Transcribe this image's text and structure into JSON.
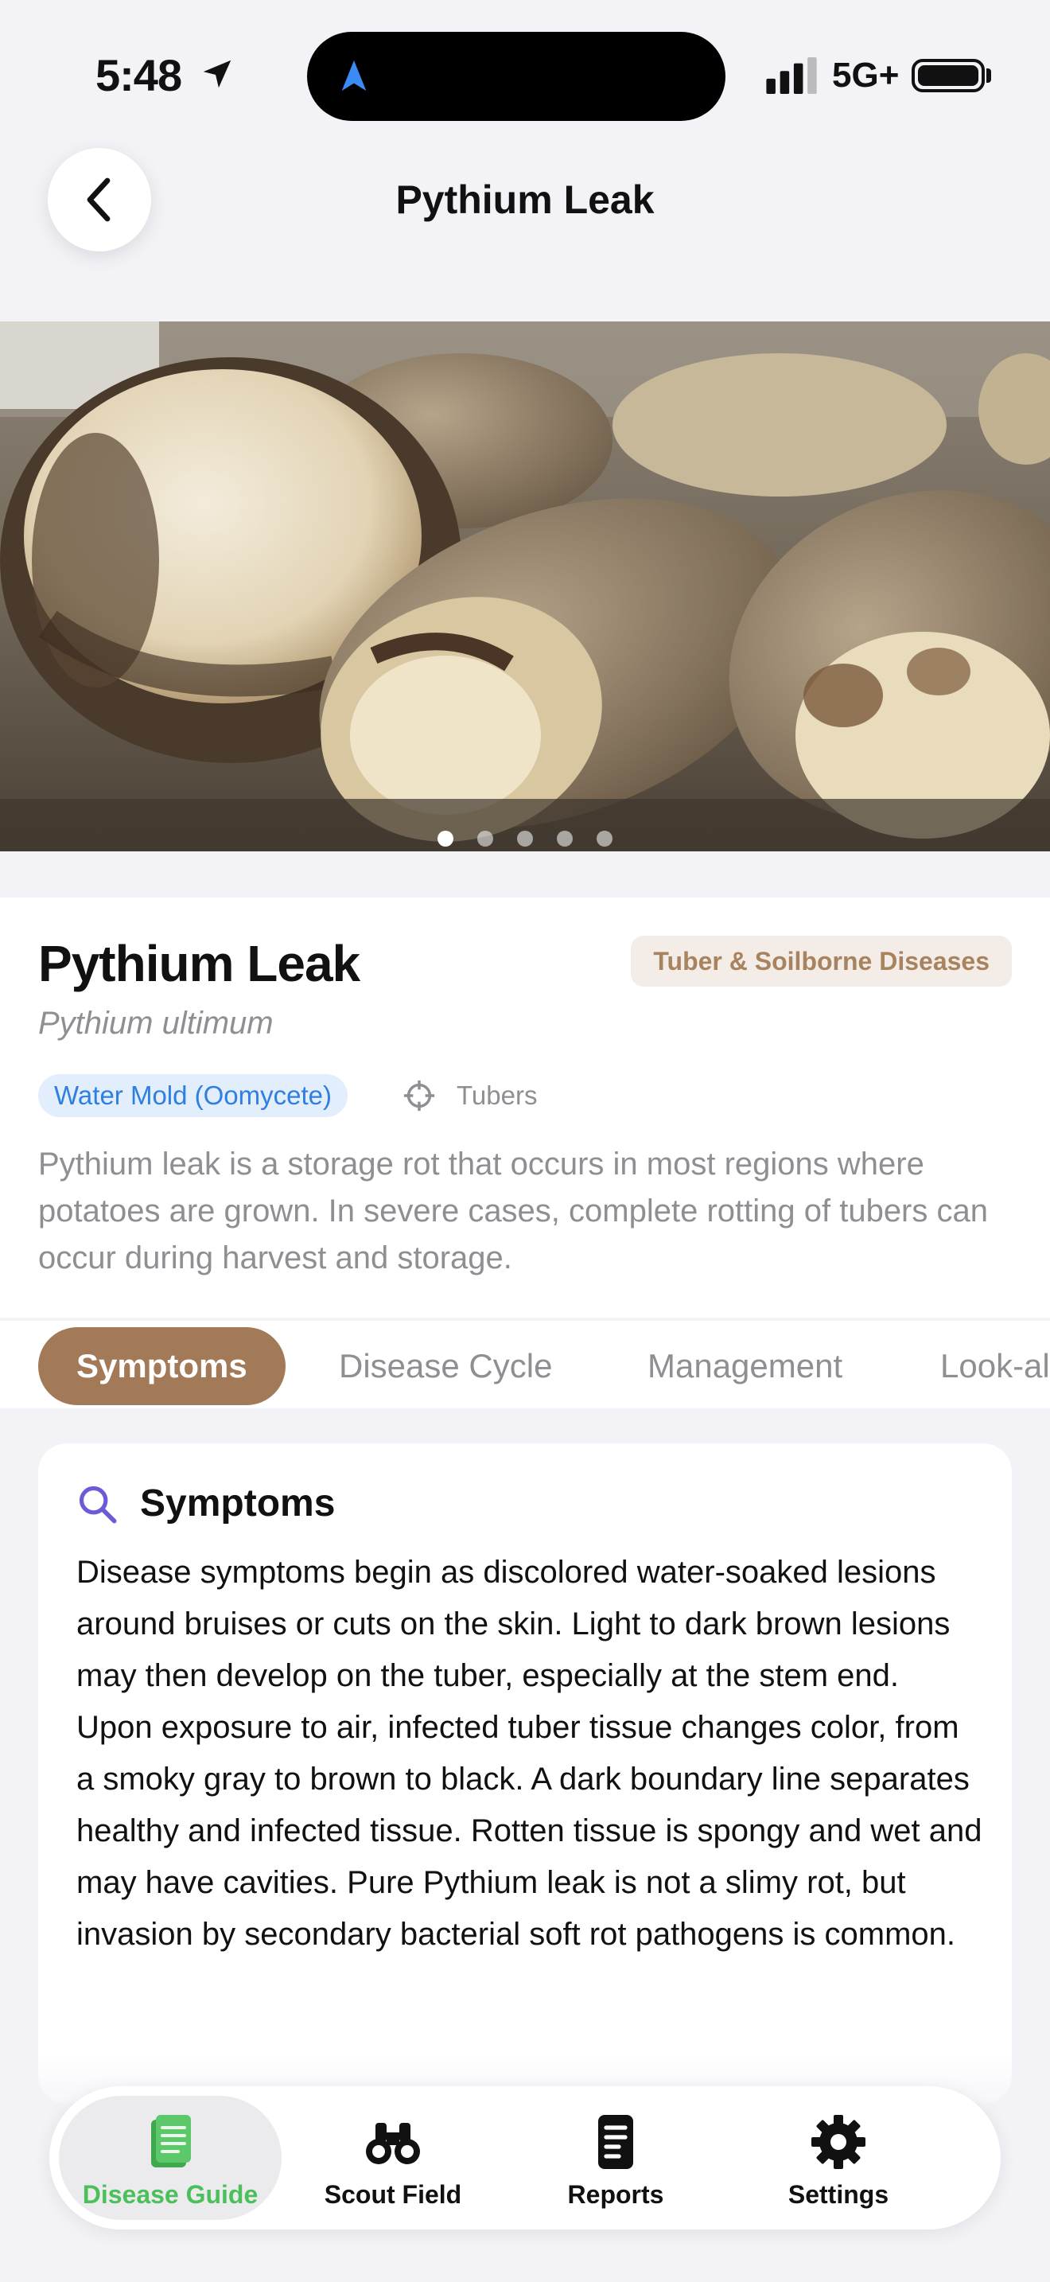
{
  "status_bar": {
    "time": "5:48",
    "network": "5G+",
    "icons": [
      "location-arrow-icon",
      "navigation-icon",
      "signal-bars-icon",
      "battery-icon"
    ]
  },
  "nav": {
    "title": "Pythium Leak",
    "back_icon": "chevron-left-icon"
  },
  "gallery": {
    "image_count": 5,
    "active_index": 0
  },
  "disease": {
    "name": "Pythium Leak",
    "scientific_name": "Pythium ultimum",
    "category": "Tuber & Soilborne Diseases",
    "pathogen_type": "Water Mold (Oomycete)",
    "host_part": "Tubers",
    "description": "Pythium leak is a storage rot that occurs in most regions where potatoes are grown. In severe cases, complete rotting of tubers can occur during harvest and storage."
  },
  "tabs": [
    {
      "label": "Symptoms",
      "active": true
    },
    {
      "label": "Disease Cycle",
      "active": false
    },
    {
      "label": "Management",
      "active": false
    },
    {
      "label": "Look-al",
      "active": false
    }
  ],
  "section": {
    "icon": "search-icon",
    "title": "Symptoms",
    "body": "Disease symptoms begin as discolored water-soaked lesions around bruises or cuts on the skin. Light to dark brown lesions may then develop on the tuber, especially at the stem end. Upon exposure to air, infected tuber tissue changes color, from a smoky gray to brown to black. A dark boundary line separates healthy and infected tissue. Rotten tissue is spongy and wet and may have cavities. Pure Pythium leak is not a slimy rot, but invasion by secondary bacterial soft rot pathogens is common."
  },
  "tabbar": [
    {
      "label": "Disease Guide",
      "icon": "book-icon",
      "active": true
    },
    {
      "label": "Scout Field",
      "icon": "binoculars-icon",
      "active": false
    },
    {
      "label": "Reports",
      "icon": "document-icon",
      "active": false
    },
    {
      "label": "Settings",
      "icon": "gear-icon",
      "active": false
    }
  ],
  "colors": {
    "accent_brown": "#a37a58",
    "category_text": "#a8835f",
    "category_bg": "#f4ede7",
    "type_blue": "#2f7fe0",
    "type_bg": "#e3eefc",
    "active_green": "#4bbf59",
    "search_icon": "#6b5bd6"
  }
}
